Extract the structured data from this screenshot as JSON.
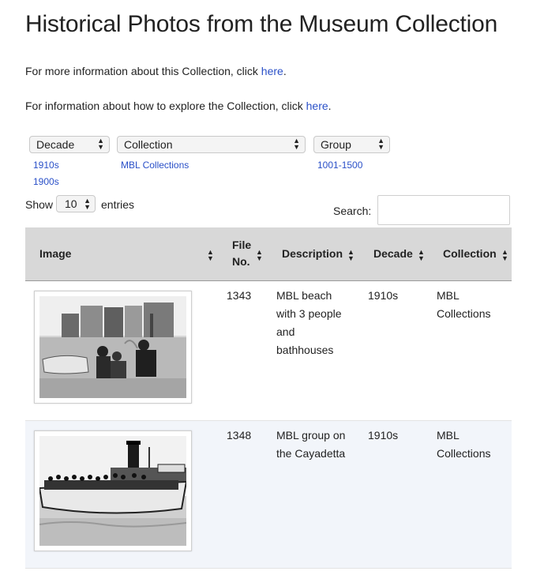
{
  "page": {
    "title": "Historical Photos from the Museum Collection",
    "info1_text": "For more information about this Collection, click ",
    "info1_link": "here",
    "info2_text": "For information about how to explore the Collection, click ",
    "info2_link": "here",
    "period": "."
  },
  "filters": {
    "decade": {
      "label": "Decade",
      "options": [
        "1910s",
        "1900s"
      ]
    },
    "collection": {
      "label": "Collection",
      "options": [
        "MBL Collections"
      ]
    },
    "group": {
      "label": "Group",
      "options": [
        "1001-1500"
      ]
    }
  },
  "table_controls": {
    "show_label": "Show",
    "entries_value": "10",
    "entries_label": "entries",
    "search_label": "Search:",
    "search_value": ""
  },
  "table": {
    "columns": [
      "Image",
      "File",
      "No.",
      "Description",
      "Decade",
      "Collection"
    ],
    "rows": [
      {
        "image_icon": "photo-beach-bathhouses",
        "file_no": "1343",
        "description": [
          "MBL beach",
          "with 3 people",
          "and",
          "bathhouses"
        ],
        "decade": "1910s",
        "collection": [
          "MBL",
          "Collections"
        ]
      },
      {
        "image_icon": "photo-steamboat-group",
        "file_no": "1348",
        "description": [
          "MBL group on",
          "the Cayadetta"
        ],
        "decade": "1910s",
        "collection": [
          "MBL",
          "Collections"
        ]
      }
    ]
  },
  "colors": {
    "link": "#2a50c8",
    "header_bg": "#d8d8d8",
    "row_alt": "#f2f5fa"
  }
}
